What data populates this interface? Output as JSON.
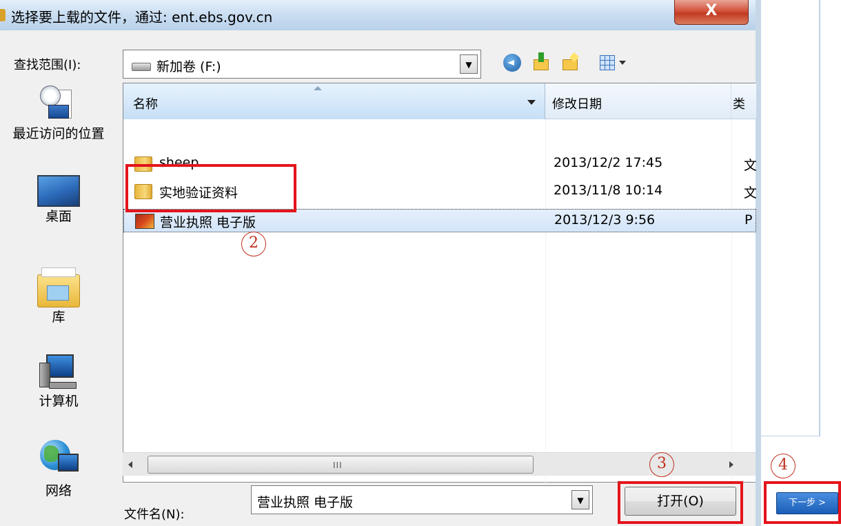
{
  "window": {
    "title": "选择要上载的文件，通过: ent.ebs.gov.cn",
    "close_label": "X"
  },
  "lookin": {
    "label": "查找范围(I):",
    "value": "新加卷 (F:)"
  },
  "toolbar": {
    "icons": [
      "back-icon",
      "up-folder-icon",
      "new-folder-icon",
      "views-menu-icon"
    ]
  },
  "places": [
    {
      "label": "最近访问的位置",
      "icon": "recent-places-icon"
    },
    {
      "label": "桌面",
      "icon": "desktop-icon"
    },
    {
      "label": "库",
      "icon": "library-icon"
    },
    {
      "label": "计算机",
      "icon": "computer-icon"
    },
    {
      "label": "网络",
      "icon": "network-icon"
    }
  ],
  "filelist": {
    "columns": [
      "名称",
      "修改日期",
      "类"
    ],
    "rows": [
      {
        "name": "sheep",
        "date": "2013/12/2 17:45",
        "type": "文",
        "icon": "folder-icon"
      },
      {
        "name": "实地验证资料",
        "date": "2013/11/8 10:14",
        "type": "文",
        "icon": "folder-icon"
      },
      {
        "name": "营业执照 电子版",
        "date": "2013/12/3 9:56",
        "type": "P",
        "icon": "image-file-icon",
        "selected": true
      }
    ]
  },
  "scrollbar": {
    "grip": "III"
  },
  "filename": {
    "label": "文件名(N):",
    "value": "营业执照 电子版"
  },
  "buttons": {
    "open_label": "打开(O)",
    "next_label": "下一步 >"
  },
  "annotations": {
    "marker_2": "2",
    "marker_3": "3",
    "marker_4": "4",
    "color": "#e5141c"
  },
  "colors": {
    "titlebar": "#c9ddf1",
    "selection": "#d3e5fa",
    "close_button": "#c23a22"
  }
}
